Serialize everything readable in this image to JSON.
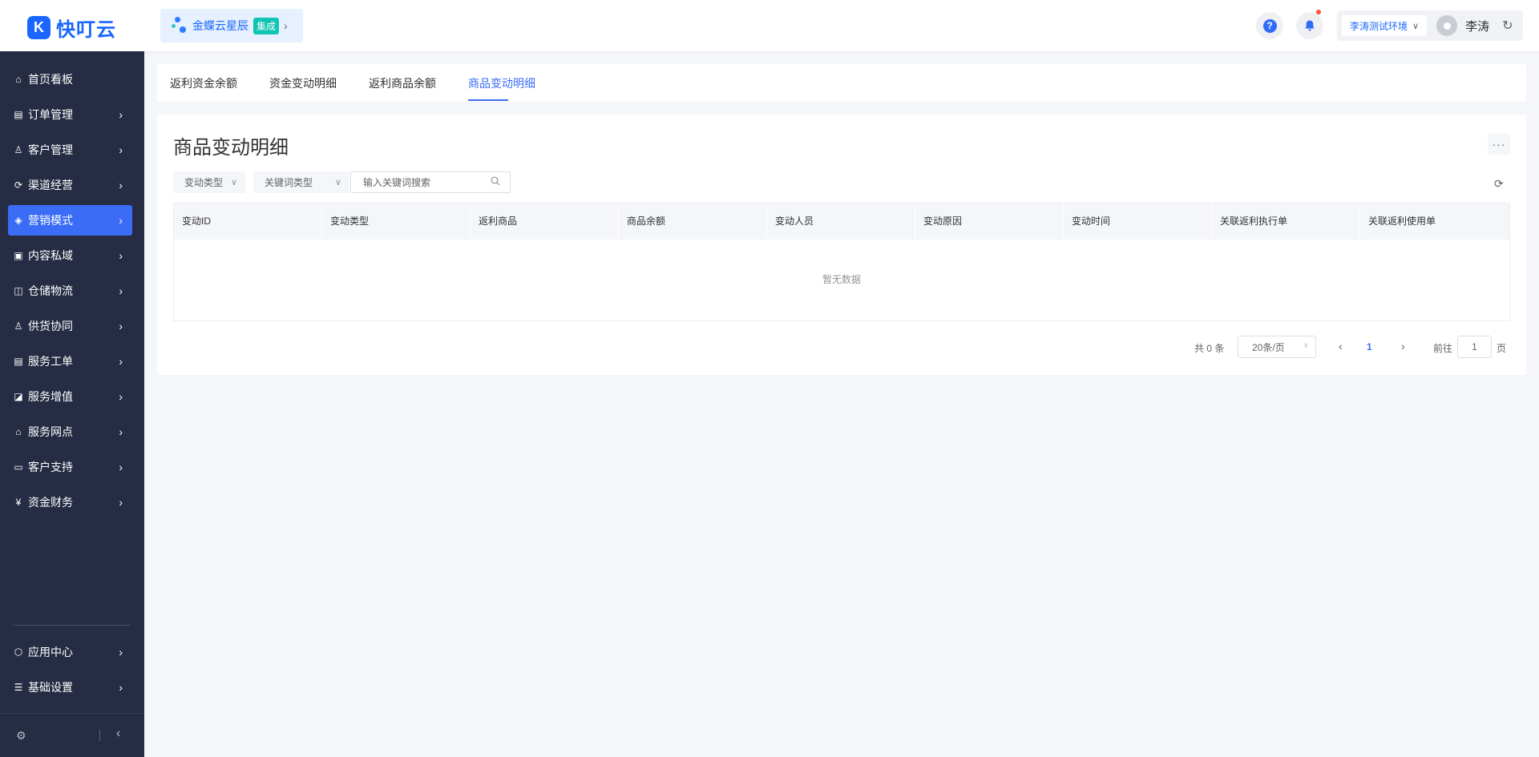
{
  "header": {
    "logo_text": "快叮云",
    "org_name": "金蝶云星辰",
    "org_badge": "集成",
    "env_label": "李涛测试环境",
    "user_name": "李涛"
  },
  "sidebar": {
    "items": [
      {
        "label": "首页看板"
      },
      {
        "label": "订单管理"
      },
      {
        "label": "客户管理"
      },
      {
        "label": "渠道经营"
      },
      {
        "label": "营销模式"
      },
      {
        "label": "内容私域"
      },
      {
        "label": "仓储物流"
      },
      {
        "label": "供货协同"
      },
      {
        "label": "服务工单"
      },
      {
        "label": "服务增值"
      },
      {
        "label": "服务网点"
      },
      {
        "label": "客户支持"
      },
      {
        "label": "资金财务"
      }
    ],
    "bottom_items": [
      {
        "label": "应用中心"
      },
      {
        "label": "基础设置"
      }
    ],
    "active_item": "营销模式"
  },
  "tabs": [
    {
      "label": "返利资金余额"
    },
    {
      "label": "资金变动明细"
    },
    {
      "label": "返利商品余额"
    },
    {
      "label": "商品变动明细"
    }
  ],
  "active_tab": "商品变动明细",
  "main": {
    "title": "商品变动明细",
    "more_label": "···",
    "filters": {
      "change_type": "变动类型",
      "keyword_type": "关键词类型",
      "search_placeholder": "输入关键词搜索"
    },
    "table": {
      "columns": [
        "变动ID",
        "变动类型",
        "返利商品",
        "商品余额",
        "变动人员",
        "变动原因",
        "变动时间",
        "关联返利执行单",
        "关联返利使用单"
      ],
      "rows": [],
      "empty_text": "暂无数据"
    },
    "pagination": {
      "total_text": "共 0 条",
      "page_size": "20条/页",
      "current_page": "1",
      "goto_label": "前往",
      "goto_value": "1",
      "goto_unit": "页"
    }
  },
  "colors": {
    "primary": "#3b6cf6",
    "sidebar_bg": "#252c43",
    "page_bg": "#f4f6f9",
    "badge": "#10c4b4",
    "notification_dot": "#f5533d"
  }
}
